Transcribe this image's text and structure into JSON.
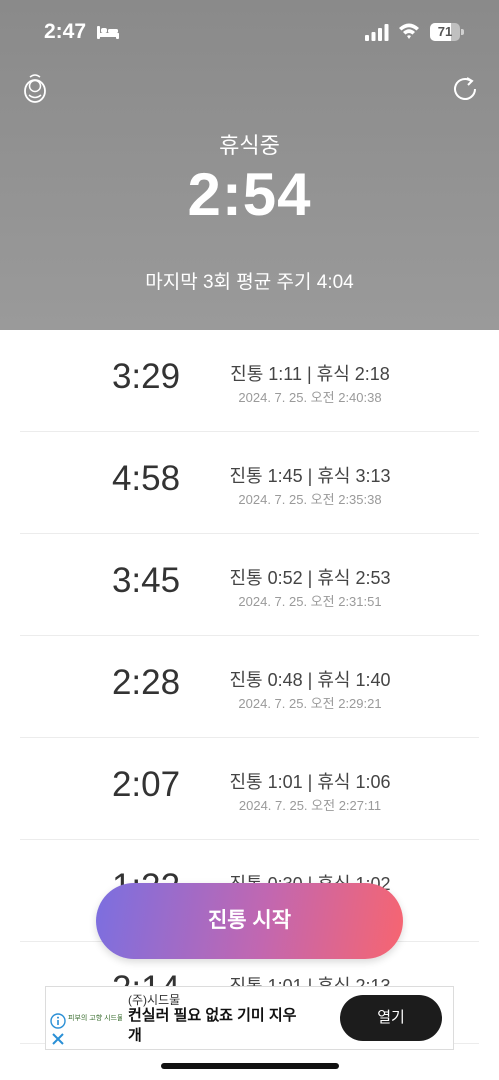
{
  "status_bar": {
    "time": "2:47",
    "battery_level": "71",
    "battery_fraction": 0.71
  },
  "header": {
    "state_label": "휴식중",
    "timer": "2:54",
    "average_label": "마지막 3회 평균 주기 4:04"
  },
  "records": [
    {
      "interval": "3:29",
      "detail": "진통 1:11 | 휴식 2:18",
      "datetime": "2024. 7. 25. 오전 2:40:38"
    },
    {
      "interval": "4:58",
      "detail": "진통 1:45 | 휴식 3:13",
      "datetime": "2024. 7. 25. 오전 2:35:38"
    },
    {
      "interval": "3:45",
      "detail": "진통 0:52 | 휴식 2:53",
      "datetime": "2024. 7. 25. 오전 2:31:51"
    },
    {
      "interval": "2:28",
      "detail": "진통 0:48 | 휴식 1:40",
      "datetime": "2024. 7. 25. 오전 2:29:21"
    },
    {
      "interval": "2:07",
      "detail": "진통 1:01 | 휴식 1:06",
      "datetime": "2024. 7. 25. 오전 2:27:11"
    },
    {
      "interval": "1:32",
      "detail": "진통 0:30 | 휴식 1:02",
      "datetime": ""
    },
    {
      "interval": "2:14",
      "detail": "진통 1:01 | 휴식 2:13",
      "datetime": ""
    }
  ],
  "start_button": {
    "label": "진통 시작"
  },
  "ad": {
    "brand": "(주)시드물",
    "headline": "컨실러 필요 없죠 기미 지우개",
    "logo_text": "피부의 고향 시드물",
    "open_label": "열기"
  },
  "colors": {
    "header_bg": "#8f8f8f",
    "button_gradient_start": "#7b6fe0",
    "button_gradient_end": "#f76570",
    "ad_button": "#1c1c1c"
  }
}
